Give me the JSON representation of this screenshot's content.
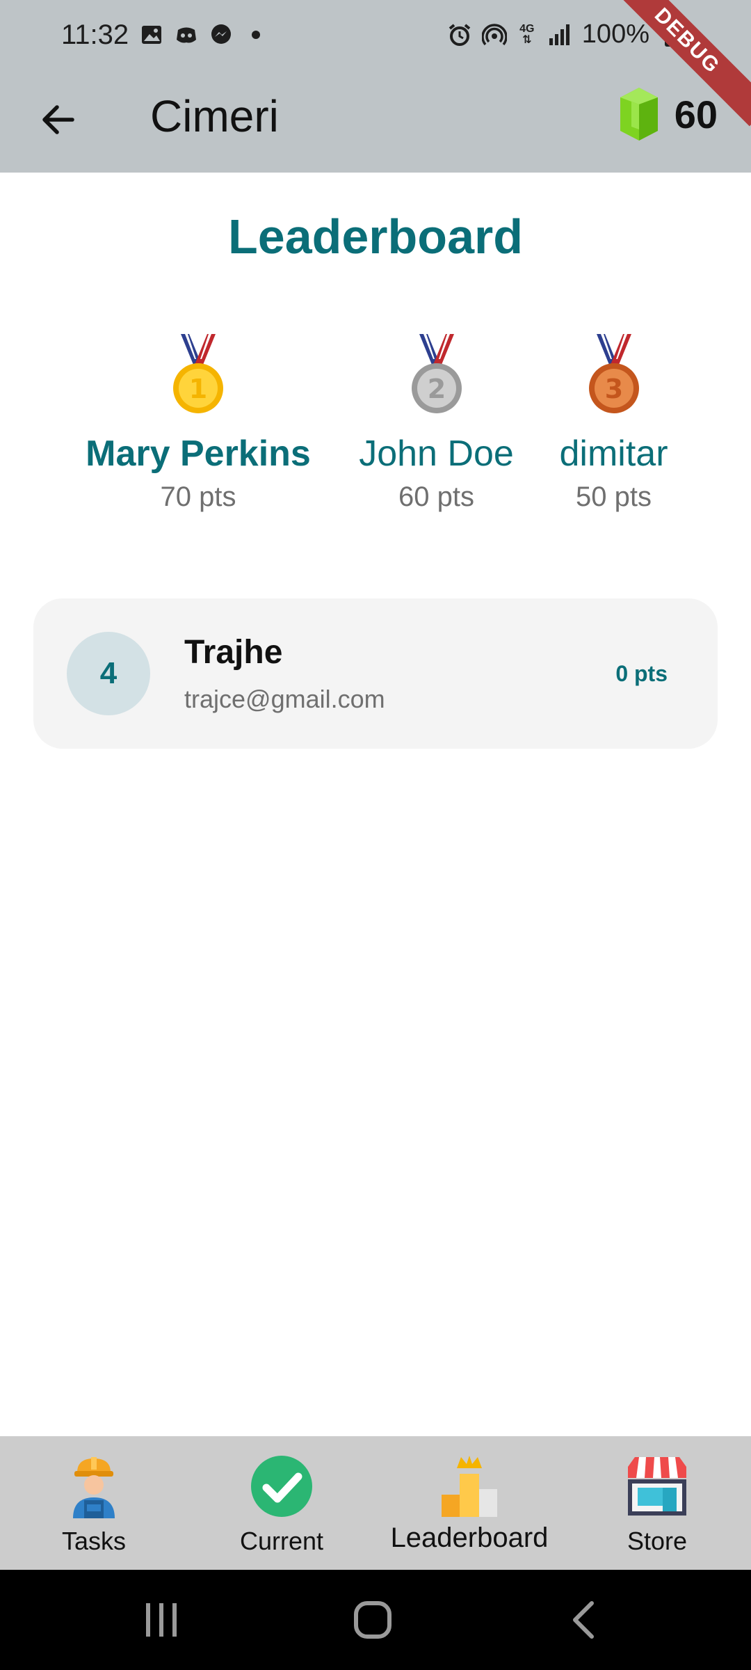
{
  "status_bar": {
    "time": "11:32",
    "battery": "100%",
    "network": "4G"
  },
  "app_bar": {
    "title": "Cimeri",
    "gem_count": "60",
    "debug_label": "DEBUG"
  },
  "leaderboard": {
    "title": "Leaderboard",
    "podium": [
      {
        "place": 1,
        "name": "Mary Perkins",
        "points": "70 pts"
      },
      {
        "place": 2,
        "name": "John Doe",
        "points": "60 pts"
      },
      {
        "place": 3,
        "name": "dimitar",
        "points": "50 pts"
      }
    ],
    "ranks": [
      {
        "rank": "4",
        "name": "Trajhe",
        "email": "trajce@gmail.com",
        "points": "0 pts"
      }
    ]
  },
  "bottom_nav": {
    "items": [
      {
        "label": "Tasks",
        "icon": "worker-icon"
      },
      {
        "label": "Current",
        "icon": "check-circle-icon"
      },
      {
        "label": "Leaderboard",
        "icon": "podium-crown-icon",
        "active": true
      },
      {
        "label": "Store",
        "icon": "store-icon"
      }
    ]
  },
  "colors": {
    "accent": "#0b6e78",
    "appbar": "#bec4c7",
    "gem": "#7ed321"
  }
}
